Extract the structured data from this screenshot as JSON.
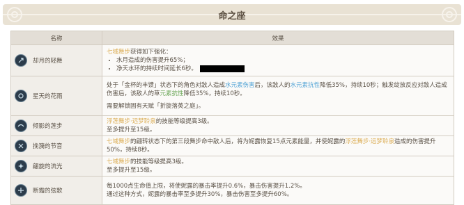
{
  "header": {
    "title": "命之座"
  },
  "table": {
    "col_name": "名称",
    "col_effect": "效果",
    "rows": [
      {
        "name": "却月的轻舞",
        "icon": "hydro-constellation-icon",
        "effect": {
          "p1": "七域舞步",
          "p2": "获得如下强化：",
          "b1": "水月造成的伤害提升65%；",
          "b2": "净天水环的持续时间延长6秒。"
        }
      },
      {
        "name": "星天的花雨",
        "icon": "hydro-constellation-icon",
        "effect": {
          "s1": "处于「金杯的丰馈」状态下的角色对敌人造成",
          "s2": "水元素伤害",
          "s3": "后，该敌人的",
          "s4": "水元素抗性",
          "s5": "降低35%，持续10秒；触发绽放反应对敌人造成伤害后，该敌人的草",
          "s6": "元素抗性",
          "s7": "降低35%，持续10秒。",
          "note": "需要解锁固有天赋「折旋落英之庭」。"
        }
      },
      {
        "name": "倾影的莲步",
        "icon": "hydro-constellation-icon",
        "effect": {
          "skill": "浮莲舞步·远梦聆泉",
          "p1": "的技能等级提高3级。",
          "p2": "至多提升至15级。"
        }
      },
      {
        "name": "挽漪的节音",
        "icon": "hydro-constellation-icon",
        "effect": {
          "skill": "七域舞步",
          "p1": "的翩转状态下的第三段舞步命中敌人后，将为妮露恢复15点元素能量，并使妮露的",
          "skill2": "浮莲舞步·远梦聆泉",
          "p2": "造成的伤害提升50%，持续8秒。"
        }
      },
      {
        "name": "翩旋的流光",
        "icon": "hydro-constellation-icon",
        "effect": {
          "skill": "七域舞步",
          "p1": "的技能等级提高3级。",
          "p2": "至多提升至15级。"
        }
      },
      {
        "name": "断霜的弦歌",
        "icon": "hydro-constellation-icon",
        "effect": {
          "p1": "每1000点生命值上限，将使妮露的暴击率提升0.6%，暴击伤害提升1.2%。",
          "p2": "通过这种方式，妮露的暴击率至多提升30%，暴击伤害至多提升60%。"
        }
      }
    ]
  },
  "colors": {
    "banner": "#e9e2d4",
    "highlight_gold": "#dcae56",
    "hydro_blue": "#4fa2d5",
    "dendro_green": "#69a655",
    "icon_bg": "#2c3c4b"
  }
}
